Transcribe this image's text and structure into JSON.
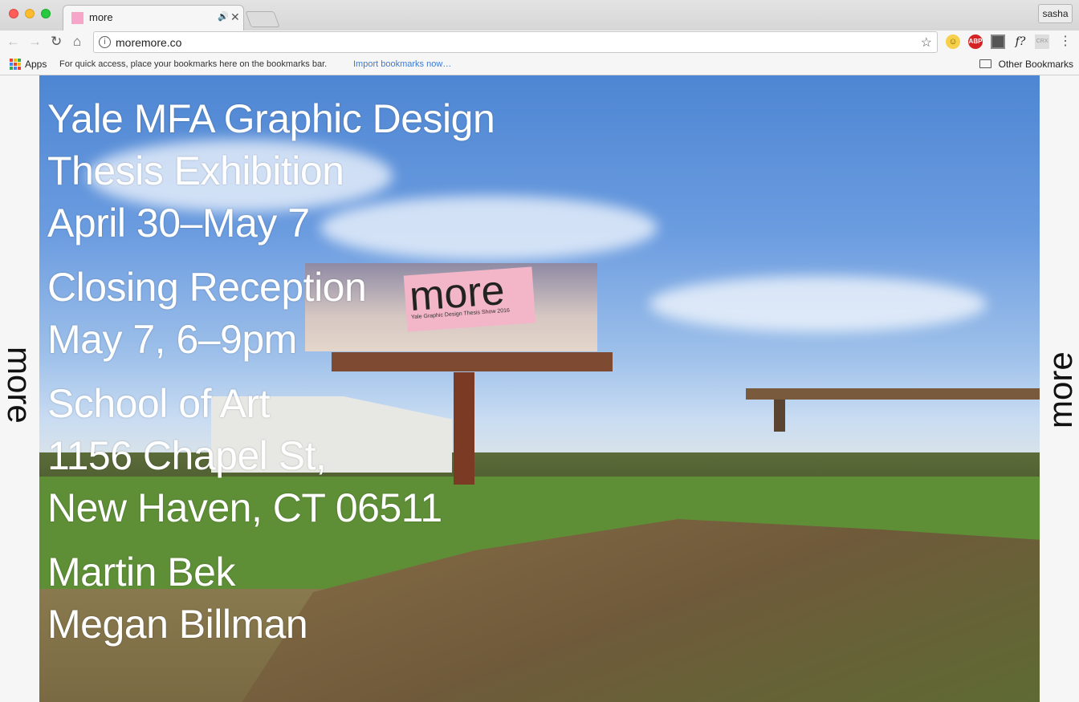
{
  "browser": {
    "tab_title": "more",
    "profile_name": "sasha",
    "url": "moremore.co",
    "bookmarks": {
      "apps_label": "Apps",
      "hint": "For quick access, place your bookmarks here on the bookmarks bar.",
      "import_link": "Import bookmarks now…",
      "other_label": "Other Bookmarks"
    },
    "extensions": [
      "emoji-face-icon",
      "adblock-plus-icon",
      "box-extension-icon",
      "font-detector-icon",
      "crx-icon"
    ]
  },
  "page": {
    "side_label_left": "more",
    "side_label_right": "more",
    "billboard": {
      "brand": "more",
      "subtitle": "Yale Graphic Design Thesis Show 2016"
    },
    "lines": {
      "l1": "Yale MFA Graphic Design",
      "l2": "Thesis Exhibition",
      "l3": "April 30–May 7",
      "l4": "Closing Reception",
      "l5": "May 7, 6–9pm",
      "l6": "School of Art",
      "l7": "1156 Chapel St,",
      "l8": "New Haven, CT 06511",
      "l9": "Martin Bek",
      "l10": "Megan Billman"
    }
  }
}
